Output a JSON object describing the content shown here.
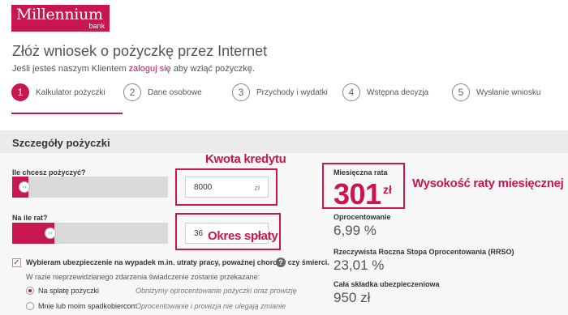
{
  "logo": {
    "brand": "Millennium",
    "sub": "bank"
  },
  "header": {
    "title": "Złóż wniosek o pożyczkę przez Internet",
    "subtitle_before": "Jeśli jesteś naszym Klientem ",
    "subtitle_link": "zaloguj się",
    "subtitle_after": " aby wziąć pożyczkę."
  },
  "steps": [
    {
      "num": "1",
      "label": "Kalkulator pożyczki",
      "active": true
    },
    {
      "num": "2",
      "label": "Dane osobowe",
      "active": false
    },
    {
      "num": "3",
      "label": "Przychody i wydatki",
      "active": false
    },
    {
      "num": "4",
      "label": "Wstępna decyzja",
      "active": false
    },
    {
      "num": "5",
      "label": "Wysłanie wniosku",
      "active": false
    }
  ],
  "section": {
    "title": "Szczegóły pożyczki"
  },
  "amount": {
    "question": "Ile chcesz pożyczyć?",
    "value": "8000",
    "unit": "zł",
    "slider_fraction": 0.02
  },
  "installments": {
    "question": "Na ile rat?",
    "value": "36",
    "slider_fraction": 0.27
  },
  "insurance": {
    "checkbox_label": "Wybieram ubezpieczenie na wypadek m.in. utraty pracy, poważnej choroby czy śmierci.",
    "checked": true,
    "info_text": "W razie nieprzewidzianego zdarzenia świadczenie zostanie przekazane:",
    "options": [
      {
        "label": "Na spłatę pożyczki",
        "description": "Obniżymy oprocentowanie pożyczki oraz prowizję",
        "selected": true
      },
      {
        "label": "Mnie lub moim spadkobiercom",
        "description": "Oprocentowanie i prowizja nie ulegają zmianie",
        "selected": false
      }
    ]
  },
  "summary": {
    "rate_label": "Miesięczna rata",
    "rate_value": "301",
    "rate_unit": "zł",
    "interest_label": "Oprocentowanie",
    "interest_value": "6,99 %",
    "rrso_label": "Rzeczywista Roczna Stopa Oprocentowania (RRSO)",
    "rrso_value": "23,01 %",
    "insurance_label": "Cała składka ubezpieczeniowa",
    "insurance_value": "950 zł"
  },
  "annotations": {
    "amount": "Kwota kredytu",
    "period": "Okres spłaty",
    "rate": "Wysokość raty miesięcznej"
  },
  "colors": {
    "brand": "#c8164e",
    "slider_track": "#d9d9d9",
    "section_band": "#ebebeb"
  }
}
